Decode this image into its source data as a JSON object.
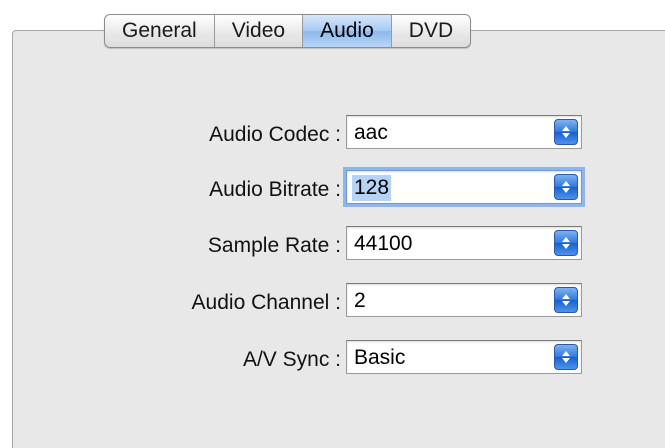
{
  "tabs": [
    {
      "label": "General",
      "selected": false
    },
    {
      "label": "Video",
      "selected": false
    },
    {
      "label": "Audio",
      "selected": true
    },
    {
      "label": "DVD",
      "selected": false
    }
  ],
  "form": {
    "audio_codec": {
      "label": "Audio Codec :",
      "value": "aac"
    },
    "audio_bitrate": {
      "label": "Audio Bitrate :",
      "value": "128"
    },
    "sample_rate": {
      "label": "Sample Rate :",
      "value": "44100"
    },
    "audio_channel": {
      "label": "Audio Channel :",
      "value": "2"
    },
    "av_sync": {
      "label": "A/V Sync :",
      "value": "Basic"
    }
  },
  "colors": {
    "accent": "#2f77de",
    "active_tab": "#a6c9f1",
    "pane_background": "#e8e8e8"
  }
}
